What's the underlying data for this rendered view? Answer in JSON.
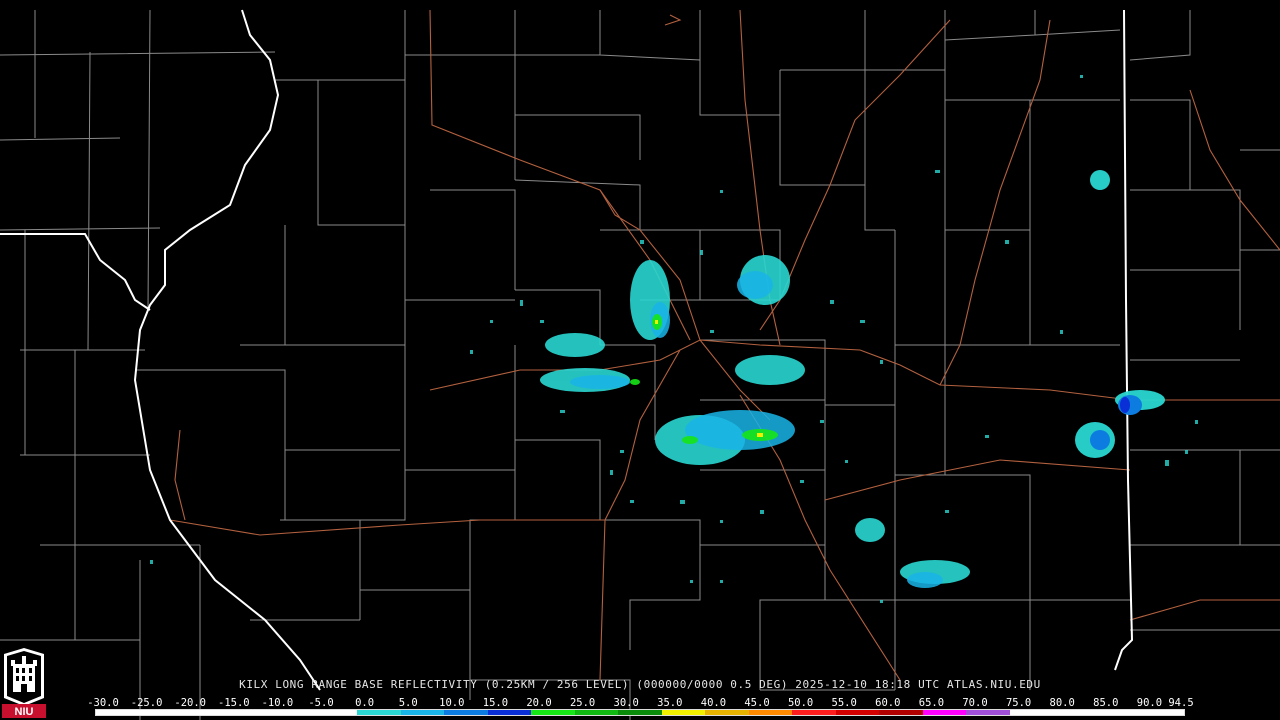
{
  "title": {
    "station": "KILX",
    "product": "LONG RANGE BASE REFLECTIVITY",
    "resolution": "(0.25KM / 256 LEVEL)",
    "volume": "(000000/0000 0.5 DEG)",
    "timestamp": "2025-12-10 18:18 UTC",
    "source": "ATLAS.NIU.EDU"
  },
  "logo": {
    "text": "NIU",
    "icon": "niu-castle-logo-icon"
  },
  "color_scale": {
    "labels": [
      "-30.0",
      "-25.0",
      "-20.0",
      "-15.0",
      "-10.0",
      "-5.0",
      "0.0",
      "5.0",
      "10.0",
      "15.0",
      "20.0",
      "25.0",
      "30.0",
      "35.0",
      "40.0",
      "45.0",
      "50.0",
      "55.0",
      "60.0",
      "65.0",
      "70.0",
      "75.0",
      "80.0",
      "85.0",
      "90.0",
      "94.5"
    ],
    "colors": [
      "#ffffff",
      "#ffffff",
      "#ffffff",
      "#ffffff",
      "#ffffff",
      "#ffffff",
      "#2ad7d2",
      "#19b4e8",
      "#0c7ce0",
      "#0a2fd6",
      "#16e616",
      "#11b811",
      "#0a8c0a",
      "#f0f000",
      "#e6b400",
      "#ff8a00",
      "#ff1e1e",
      "#d40000",
      "#b00000",
      "#ff00ff",
      "#a050d8",
      "#ffffff",
      "#ffffff",
      "#ffffff",
      "#ffffff"
    ]
  },
  "map_colors": {
    "background": "#000000",
    "county_lines": "#8a8a8a",
    "state_lines": "#ffffff",
    "highways": "#b3613f"
  }
}
